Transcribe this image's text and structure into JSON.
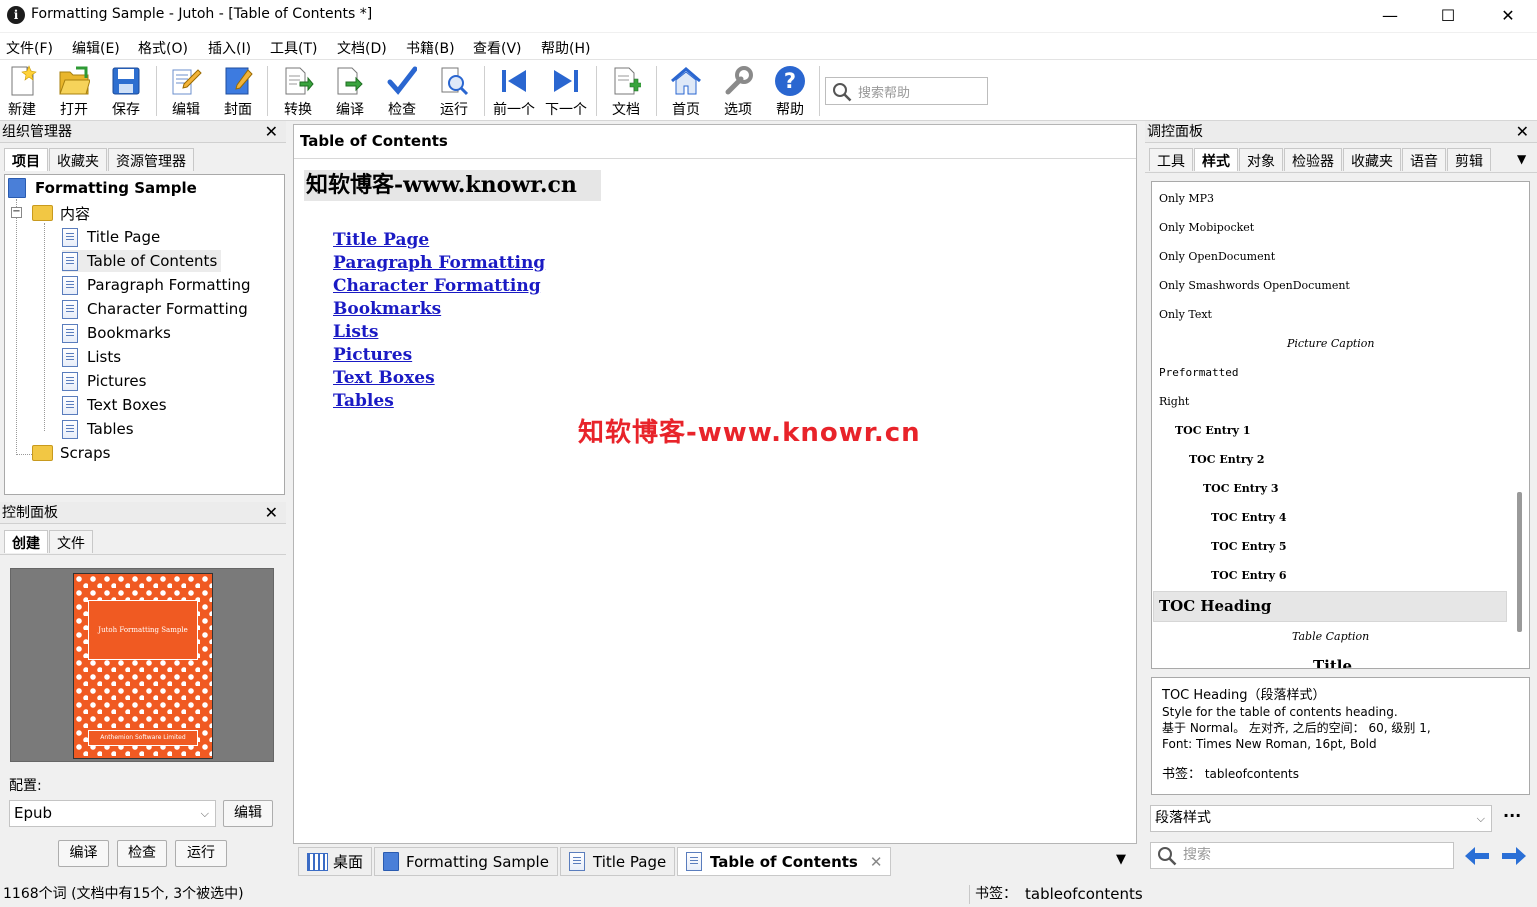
{
  "window": {
    "title": "Formatting Sample - Jutoh - [Table of Contents *]",
    "minimize": "—",
    "maximize": "☐",
    "close": "✕"
  },
  "menu": [
    "文件(F)",
    "编辑(E)",
    "格式(O)",
    "插入(I)",
    "工具(T)",
    "文档(D)",
    "书籍(B)",
    "查看(V)",
    "帮助(H)"
  ],
  "toolbar": {
    "buttons": [
      {
        "label": "新建",
        "icon": "new-file-icon"
      },
      {
        "label": "打开",
        "icon": "open-folder-icon"
      },
      {
        "label": "保存",
        "icon": "save-disk-icon"
      },
      {
        "label": "编辑",
        "icon": "edit-pencil-icon"
      },
      {
        "label": "封面",
        "icon": "cover-icon"
      },
      {
        "label": "转换",
        "icon": "convert-icon"
      },
      {
        "label": "编译",
        "icon": "compile-icon"
      },
      {
        "label": "检查",
        "icon": "check-mark-icon"
      },
      {
        "label": "运行",
        "icon": "run-preview-icon"
      },
      {
        "label": "前一个",
        "icon": "previous-icon"
      },
      {
        "label": "下一个",
        "icon": "next-icon"
      },
      {
        "label": "文档",
        "icon": "new-document-icon"
      },
      {
        "label": "首页",
        "icon": "home-icon"
      },
      {
        "label": "选项",
        "icon": "wrench-icon"
      },
      {
        "label": "帮助",
        "icon": "help-question-icon"
      }
    ],
    "search_placeholder": "搜索帮助"
  },
  "organizer": {
    "title": "组织管理器",
    "tabs": [
      "项目",
      "收藏夹",
      "资源管理器"
    ],
    "project": "Formatting Sample",
    "folder": "内容",
    "items": [
      "Title Page",
      "Table of Contents",
      "Paragraph Formatting",
      "Character Formatting",
      "Bookmarks",
      "Lists",
      "Pictures",
      "Text Boxes",
      "Tables"
    ],
    "selected": "Table of Contents",
    "scraps": "Scraps"
  },
  "control_panel": {
    "title": "控制面板",
    "tabs": [
      "创建",
      "文件"
    ],
    "cover": {
      "title": "Jutoh Formatting Sample",
      "publisher": "Anthemion Software Limited"
    },
    "config_label": "配置:",
    "config_value": "Epub",
    "edit_button": "编辑",
    "compile_button": "编译",
    "check_button": "检查",
    "run_button": "运行"
  },
  "editor": {
    "header": "Table of Contents",
    "heading": "知软博客-www.knowr.cn",
    "links": [
      "Title Page",
      "Paragraph Formatting",
      "Character Formatting",
      "Bookmarks",
      "Lists",
      "Pictures",
      "Text Boxes",
      "Tables"
    ],
    "watermark": "知软博客-www.knowr.cn"
  },
  "doc_tabs": {
    "desktop": "桌面",
    "formatting_sample": "Formatting Sample",
    "title_page": "Title Page",
    "toc": "Table of Contents"
  },
  "inspector": {
    "title": "调控面板",
    "tabs": [
      "工具",
      "样式",
      "对象",
      "检验器",
      "收藏夹",
      "语音",
      "剪辑"
    ],
    "styles": {
      "only_mp3": "Only MP3",
      "only_mobipocket": "Only Mobipocket",
      "only_opendocument": "Only OpenDocument",
      "only_smashwords": "Only Smashwords OpenDocument",
      "only_text": "Only Text",
      "picture_caption": "Picture Caption",
      "preformatted": "Preformatted",
      "right": "Right",
      "toc1": "TOC Entry 1",
      "toc2": "TOC Entry 2",
      "toc3": "TOC Entry 3",
      "toc4": "TOC Entry 4",
      "toc5": "TOC Entry 5",
      "toc6": "TOC Entry 6",
      "toc_heading": "TOC Heading",
      "table_caption": "Table Caption",
      "title": "Title"
    },
    "desc": {
      "name": "TOC Heading",
      "kind": "（段落样式）",
      "line1": "Style for the table of contents heading.",
      "line2": "基于 Normal。 左对齐, 之后的空间： 60, 级别 1,",
      "line3": "Font: Times New Roman, 16pt, Bold",
      "bookmark_label": "书签：",
      "bookmark_value": "tableofcontents"
    },
    "style_type": "段落样式",
    "search_placeholder": "搜索"
  },
  "status": {
    "left": "1168个词 (文档中有15个, 3个被选中)",
    "bookmark_label": "书签：",
    "bookmark_value": "tableofcontents"
  },
  "colors": {
    "link": "#1a1ac4",
    "watermark": "#e8232a",
    "cover": "#f05a22",
    "selected_style": "#e6e6e6",
    "accent": "#2a6fd6"
  }
}
